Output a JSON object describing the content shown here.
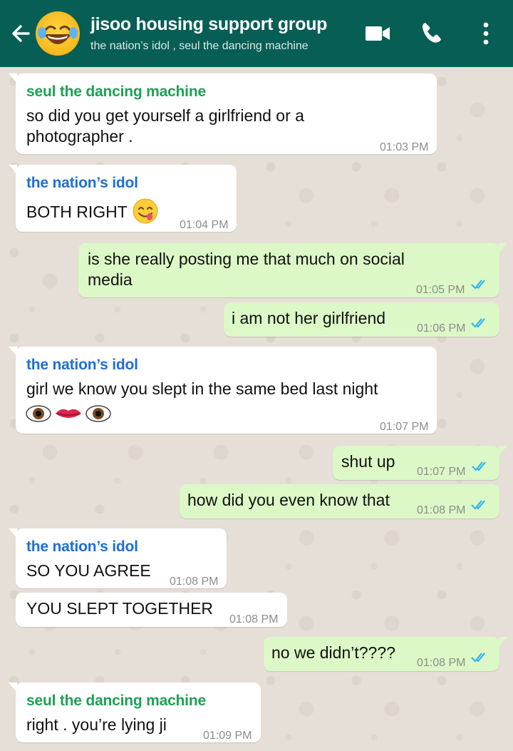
{
  "header": {
    "title": "jisoo housing support group",
    "subtitle": "the nation’s idol , seul the dancing machine",
    "avatar_icon": "laughing-face-emoji",
    "icons": [
      "back-arrow-icon",
      "video-call-icon",
      "phone-icon",
      "more-options-icon"
    ]
  },
  "colors": {
    "header_bg": "#075e54",
    "incoming_bubble": "#ffffff",
    "outgoing_bubble": "#dcf8c6",
    "sender_green": "#1fa055",
    "sender_blue": "#1f6fd0",
    "read_ticks": "#34b7f1"
  },
  "messages": [
    {
      "dir": "in",
      "sender": "seul the dancing machine",
      "lines": [
        "so did you get yourself a girlfriend or a",
        "photographer ."
      ],
      "time": "01:03 PM"
    },
    {
      "dir": "in",
      "sender": "the nation’s idol",
      "lines": [
        "BOTH RIGHT"
      ],
      "emoji": "yum-face-emoji",
      "time": "01:04 PM"
    },
    {
      "dir": "out",
      "lines": [
        "is she really posting me that much on social",
        "media"
      ],
      "time": "01:05 PM",
      "status": "read"
    },
    {
      "dir": "out",
      "lines": [
        "i am not her girlfriend"
      ],
      "time": "01:06 PM",
      "status": "read"
    },
    {
      "dir": "in",
      "sender": "the nation’s idol",
      "lines": [
        "girl we know you slept in the same bed last night"
      ],
      "emoji": "eye-lips-eye-emoji",
      "time": "01:07 PM"
    },
    {
      "dir": "out",
      "lines": [
        "shut up"
      ],
      "time": "01:07 PM",
      "status": "read"
    },
    {
      "dir": "out",
      "lines": [
        "how did you even know that"
      ],
      "time": "01:08 PM",
      "status": "read"
    },
    {
      "dir": "in",
      "sender": "the nation’s idol",
      "lines": [
        "SO YOU AGREE"
      ],
      "time": "01:08 PM"
    },
    {
      "dir": "in",
      "lines": [
        "YOU SLEPT TOGETHER"
      ],
      "time": "01:08 PM"
    },
    {
      "dir": "out",
      "lines": [
        "no we didn’t????"
      ],
      "time": "01:08 PM",
      "status": "read"
    },
    {
      "dir": "in",
      "sender": "seul the dancing machine",
      "lines": [
        "right . you’re lying ji"
      ],
      "time": "01:09 PM"
    }
  ]
}
